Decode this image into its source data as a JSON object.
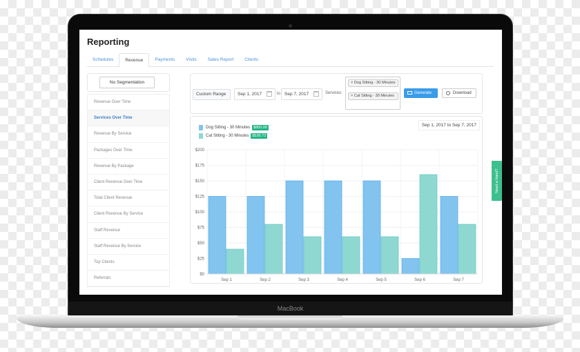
{
  "device": {
    "brand": "MacBook"
  },
  "page": {
    "title": "Reporting"
  },
  "tabs": [
    {
      "label": "Schedules",
      "active": false
    },
    {
      "label": "Revenue",
      "active": true
    },
    {
      "label": "Payments",
      "active": false
    },
    {
      "label": "Visits",
      "active": false
    },
    {
      "label": "Sales Report",
      "active": false
    },
    {
      "label": "Clients",
      "active": false
    }
  ],
  "segmentation": {
    "label": "No Segmentation"
  },
  "menu": [
    {
      "label": "Revenue Over Time",
      "active": false
    },
    {
      "label": "Services Over Time",
      "active": true
    },
    {
      "label": "Revenue By Service",
      "active": false
    },
    {
      "label": "Packages Over Time",
      "active": false
    },
    {
      "label": "Revenue By Package",
      "active": false
    },
    {
      "label": "Client Revenue Over Time",
      "active": false
    },
    {
      "label": "Total Client Revenue",
      "active": false
    },
    {
      "label": "Client Revenue By Service",
      "active": false
    },
    {
      "label": "Staff Revenue",
      "active": false
    },
    {
      "label": "Staff Revenue By Service",
      "active": false
    },
    {
      "label": "Top Clients",
      "active": false
    },
    {
      "label": "Referrals",
      "active": false
    }
  ],
  "filters": {
    "range": "Custom Range",
    "start_date": "Sep 1, 2017",
    "to_label": "to",
    "end_date": "Sep 7, 2017",
    "services_label": "Services:",
    "services": [
      "Dog Sitting - 30 Minutes",
      "Cat Sitting - 30 Minutes"
    ],
    "remove_glyph": "×",
    "generate_label": "Generate",
    "download_label": "Download"
  },
  "legend": [
    {
      "name": "Dog Sitting - 30 Minutes",
      "total": "$850.00",
      "color": "#82c3f0"
    },
    {
      "name": "Cat Sitting - 30 Minutes",
      "total": "$539.73",
      "color": "#8fd8d2"
    }
  ],
  "date_range_display": "Sep 1, 2017 to Sep 7, 2017",
  "help_tab": "Need a Hand?",
  "chart_data": {
    "type": "bar",
    "title": "",
    "xlabel": "",
    "ylabel": "",
    "categories": [
      "Sep 1",
      "Sep 2",
      "Sep 3",
      "Sep 4",
      "Sep 5",
      "Sep 6",
      "Sep 7"
    ],
    "series": [
      {
        "name": "Dog Sitting - 30 Minutes",
        "values": [
          125,
          125,
          150,
          150,
          150,
          25,
          125
        ],
        "color": "#82c3f0",
        "stroke": "#5fb0ec"
      },
      {
        "name": "Cat Sitting - 30 Minutes",
        "values": [
          40,
          80,
          60,
          60,
          60,
          160,
          80
        ],
        "color": "#8fd8d2",
        "stroke": "#6ccbc3"
      }
    ],
    "ylim": [
      0,
      200
    ],
    "yticks": [
      0,
      25,
      50,
      75,
      100,
      125,
      150,
      175,
      200
    ],
    "ytick_prefix": "$",
    "grid": true,
    "legend_position": "top-left"
  }
}
